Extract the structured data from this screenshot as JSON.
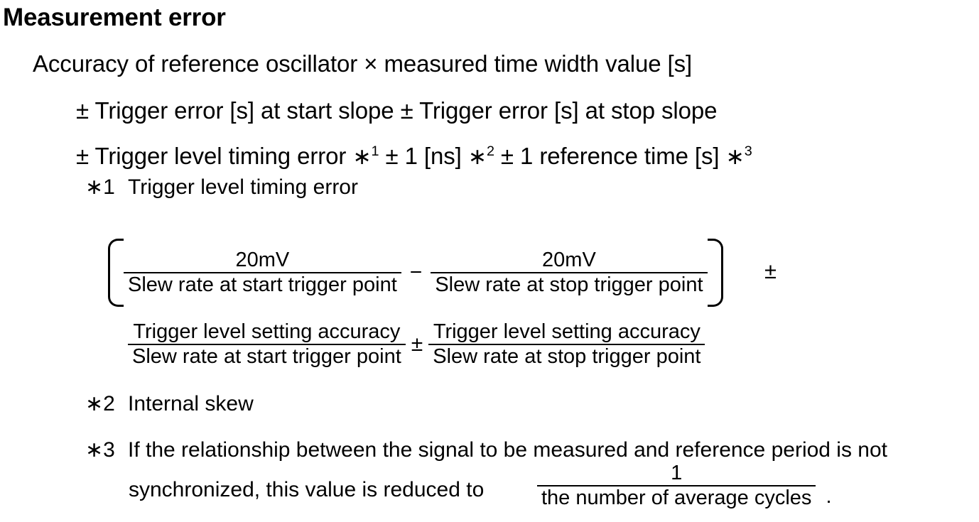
{
  "title": "Measurement error",
  "lines": {
    "accuracy": "Accuracy of reference oscillator × measured time width value [s]",
    "trigger_error": "± Trigger error [s] at start slope ± Trigger error [s] at stop slope",
    "level_timing_prefix": "± Trigger level timing error ",
    "level_timing_ast1": "∗",
    "level_timing_sup1": "1",
    "level_timing_mid": " ± 1 [ns] ",
    "level_timing_ast2": "∗",
    "level_timing_sup2": "2",
    "level_timing_mid2": " ± 1 reference time [s] ",
    "level_timing_ast3": "∗",
    "level_timing_sup3": "3"
  },
  "notes": {
    "n1": {
      "marker": "∗1",
      "text": "Trigger level timing error"
    },
    "n2": {
      "marker": "∗2",
      "text": "Internal skew"
    },
    "n3": {
      "marker": "∗3",
      "text_line1": "If the relationship between the signal to be measured and reference period is not",
      "text_line2": "synchronized, this value is reduced to"
    }
  },
  "formula1": {
    "left_bracket": "[",
    "right_bracket": "]",
    "frac1": {
      "numerator": "20mV",
      "denominator": "Slew rate at start trigger point"
    },
    "operator": "−",
    "frac2": {
      "numerator": "20mV",
      "denominator": "Slew rate at stop trigger point"
    },
    "trailing_operator": "±"
  },
  "formula2": {
    "frac1": {
      "numerator": "Trigger level setting accuracy",
      "denominator": "Slew rate at start trigger point"
    },
    "operator": "±",
    "frac2": {
      "numerator": "Trigger level setting accuracy",
      "denominator": "Slew rate at stop trigger point"
    }
  },
  "formula3": {
    "frac": {
      "numerator": "1",
      "denominator": "the number of average cycles"
    },
    "period": "."
  },
  "colors": {
    "text": "#000000",
    "background": "#ffffff"
  }
}
